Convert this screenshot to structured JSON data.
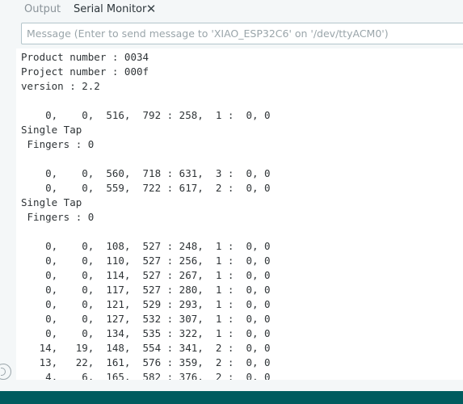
{
  "tabs": {
    "output_label": "Output",
    "serial_label": "Serial Monitor",
    "close_glyph": "✕"
  },
  "message_input": {
    "placeholder": "Message (Enter to send message to 'XIAO_ESP32C6' on '/dev/ttyACM0')",
    "value": ""
  },
  "serial_output": {
    "lines": [
      "Product number : 0034",
      "Project number : 000f",
      "version : 2.2",
      "",
      "    0,    0,  516,  792 : 258,  1 :  0, 0",
      "Single Tap",
      " Fingers : 0",
      "",
      "    0,    0,  560,  718 : 631,  3 :  0, 0",
      "    0,    0,  559,  722 : 617,  2 :  0, 0",
      "Single Tap",
      " Fingers : 0",
      "",
      "    0,    0,  108,  527 : 248,  1 :  0, 0",
      "    0,    0,  110,  527 : 256,  1 :  0, 0",
      "    0,    0,  114,  527 : 267,  1 :  0, 0",
      "    0,    0,  117,  527 : 280,  1 :  0, 0",
      "    0,    0,  121,  529 : 293,  1 :  0, 0",
      "    0,    0,  127,  532 : 307,  1 :  0, 0",
      "    0,    0,  134,  535 : 322,  1 :  0, 0",
      "   14,   19,  148,  554 : 341,  2 :  0, 0",
      "   13,   22,  161,  576 : 359,  2 :  0, 0",
      "    4,    6,  165,  582 : 376,  2 :  0, 0"
    ]
  },
  "colors": {
    "statusbar": "#005c5f",
    "input_border": "#b3c5cb"
  }
}
